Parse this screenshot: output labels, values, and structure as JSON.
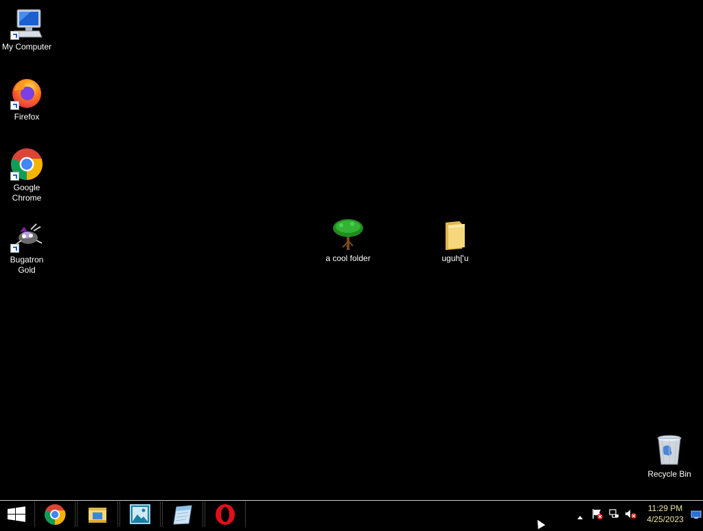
{
  "desktop": {
    "icons": [
      {
        "label": "My Computer",
        "icon": "computer-icon",
        "shortcut": true
      },
      {
        "label": "Firefox",
        "icon": "firefox-icon",
        "shortcut": true
      },
      {
        "label": "Google Chrome",
        "icon": "chrome-icon",
        "shortcut": true
      },
      {
        "label": "Bugatron Gold",
        "icon": "bugatron-icon",
        "shortcut": true
      },
      {
        "label": "a cool folder",
        "icon": "tree-icon",
        "shortcut": false
      },
      {
        "label": "uguh['u",
        "icon": "folder-icon",
        "shortcut": false
      },
      {
        "label": "Recycle Bin",
        "icon": "recycle-bin-icon",
        "shortcut": false
      }
    ]
  },
  "taskbar": {
    "pinned": [
      {
        "name": "Google Chrome",
        "icon": "chrome-icon"
      },
      {
        "name": "File Explorer",
        "icon": "file-explorer-icon"
      },
      {
        "name": "Photos",
        "icon": "photos-icon"
      },
      {
        "name": "Notes",
        "icon": "notes-icon"
      },
      {
        "name": "Opera",
        "icon": "opera-icon"
      }
    ],
    "tray": {
      "clock_time": "11:29 PM",
      "clock_date": "4/25/2023"
    }
  },
  "colors": {
    "background": "#000000",
    "clock_text": "#f0e6a0",
    "taskbar_border": "#cfcfcf"
  }
}
